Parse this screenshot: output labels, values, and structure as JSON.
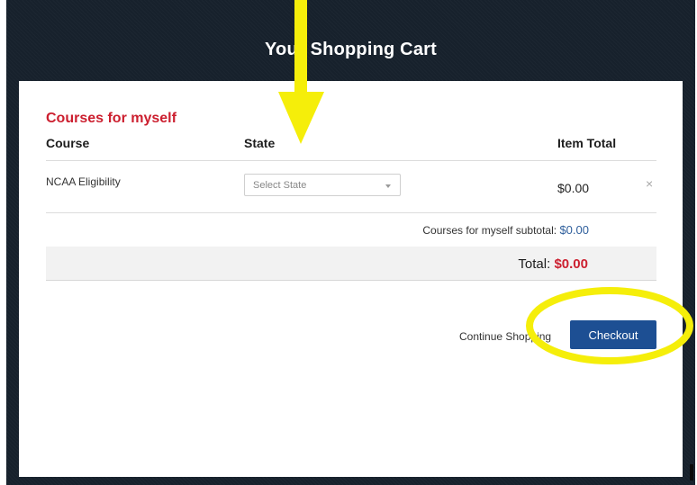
{
  "modal": {
    "title": "Your Shopping Cart"
  },
  "cart": {
    "section_title": "Courses for myself",
    "columns": {
      "course": "Course",
      "state": "State",
      "item_total": "Item Total"
    },
    "items": [
      {
        "course": "NCAA Eligibility",
        "state_placeholder": "Select State",
        "item_total": "$0.00",
        "remove_icon": "×"
      }
    ],
    "subtotal_label": "Courses for myself subtotal:",
    "subtotal_value": "$0.00",
    "total_label": "Total:",
    "total_value": "$0.00"
  },
  "actions": {
    "continue_label": "Continue Shopping",
    "checkout_label": "Checkout"
  },
  "colors": {
    "header_bg": "#17212c",
    "section_title": "#cc1f2f",
    "checkout_button": "#1d4f93",
    "total_value": "#cc1f2f",
    "subtotal_value": "#2f5f9c",
    "annotation": "#f5ee0a"
  },
  "annotations": [
    "down-arrow-icon",
    "highlight-ellipse-icon"
  ]
}
